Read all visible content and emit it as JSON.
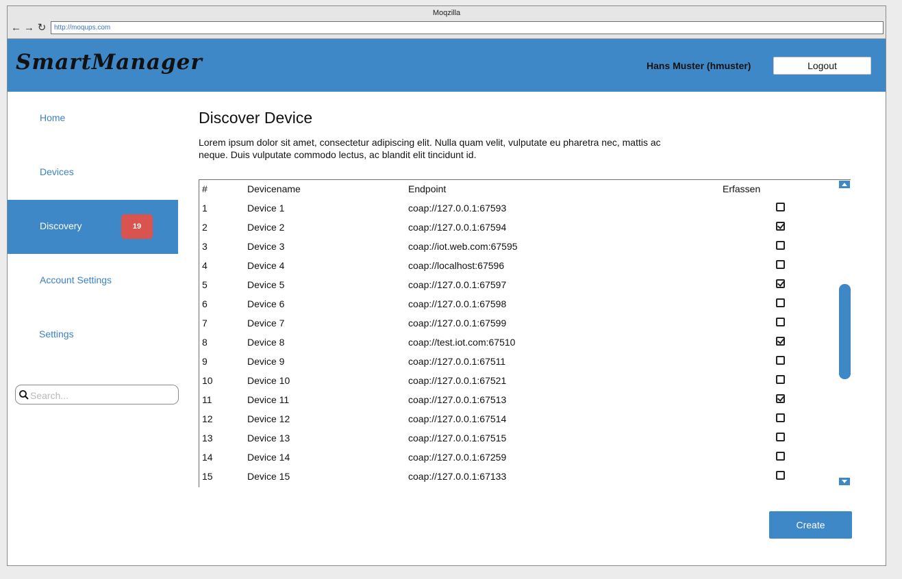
{
  "browser": {
    "title": "Moqzilla",
    "url": "http://moqups.com"
  },
  "header": {
    "logo": "SmartManager",
    "user": "Hans Muster (hmuster)",
    "logout_label": "Logout"
  },
  "sidebar": {
    "items": [
      {
        "label": "Home"
      },
      {
        "label": "Devices"
      },
      {
        "label": "Discovery",
        "badge": "19"
      },
      {
        "label": "Account Settings"
      },
      {
        "label": "Settings"
      }
    ],
    "search_placeholder": "Search..."
  },
  "main": {
    "title": "Discover Device",
    "description": "Lorem ipsum dolor sit amet, consectetur adipiscing elit. Nulla quam velit, vulputate eu pharetra nec, mattis ac neque. Duis vulputate commodo lectus, ac blandit elit tincidunt id.",
    "create_label": "Create"
  },
  "table": {
    "headers": [
      "#",
      "Devicename",
      "Endpoint",
      "Erfassen"
    ],
    "rows": [
      {
        "num": "1",
        "name": "Device 1",
        "endpoint": "coap://127.0.0.1:67593",
        "checked": false
      },
      {
        "num": "2",
        "name": "Device 2",
        "endpoint": "coap://127.0.0.1:67594",
        "checked": true
      },
      {
        "num": "3",
        "name": "Device 3",
        "endpoint": "coap://iot.web.com:67595",
        "checked": false
      },
      {
        "num": "4",
        "name": "Device 4",
        "endpoint": "coap://localhost:67596",
        "checked": false
      },
      {
        "num": "5",
        "name": "Device 5",
        "endpoint": "coap://127.0.0.1:67597",
        "checked": true
      },
      {
        "num": "6",
        "name": "Device 6",
        "endpoint": "coap://127.0.0.1:67598",
        "checked": false
      },
      {
        "num": "7",
        "name": "Device 7",
        "endpoint": "coap://127.0.0.1:67599",
        "checked": false
      },
      {
        "num": "8",
        "name": "Device 8",
        "endpoint": "coap://test.iot.com:67510",
        "checked": true
      },
      {
        "num": "9",
        "name": "Device 9",
        "endpoint": "coap://127.0.0.1:67511",
        "checked": false
      },
      {
        "num": "10",
        "name": "Device 10",
        "endpoint": "coap://127.0.0.1:67521",
        "checked": false
      },
      {
        "num": "11",
        "name": "Device 11",
        "endpoint": "coap://127.0.0.1:67513",
        "checked": true
      },
      {
        "num": "12",
        "name": "Device 12",
        "endpoint": "coap://127.0.0.1:67514",
        "checked": false
      },
      {
        "num": "13",
        "name": "Device 13",
        "endpoint": "coap://127.0.0.1:67515",
        "checked": false
      },
      {
        "num": "14",
        "name": "Device 14",
        "endpoint": "coap://127.0.0.1:67259",
        "checked": false
      },
      {
        "num": "15",
        "name": "Device 15",
        "endpoint": "coap://127.0.0.1:67133",
        "checked": false
      }
    ]
  }
}
